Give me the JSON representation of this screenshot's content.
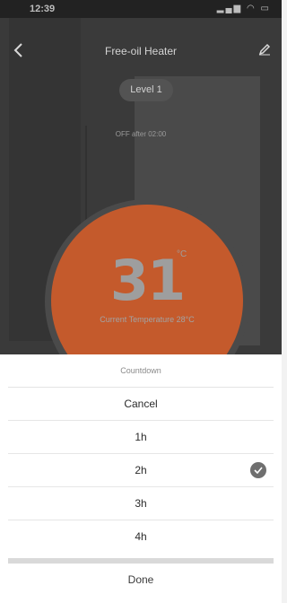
{
  "status_bar": {
    "time": "12:39",
    "icons": "signal wifi battery"
  },
  "header": {
    "title": "Free-oil Heater"
  },
  "level_label": "Level 1",
  "countdown_info": "OFF after 02:00",
  "temperature": {
    "value": "31",
    "unit": "°C",
    "current_label": "Current Temperature 28°C"
  },
  "sheet": {
    "title": "Countdown",
    "options": [
      {
        "label": "Cancel"
      },
      {
        "label": "1h"
      },
      {
        "label": "2h"
      },
      {
        "label": "3h"
      },
      {
        "label": "4h"
      }
    ],
    "selected_option": "2h",
    "done_label": "Done"
  },
  "colors": {
    "overlay_dark": "#3a3a3a",
    "temperature_circle": "#c45a2c",
    "sheet_bg": "#ffffff",
    "check_badge": "#6f6f6f"
  }
}
